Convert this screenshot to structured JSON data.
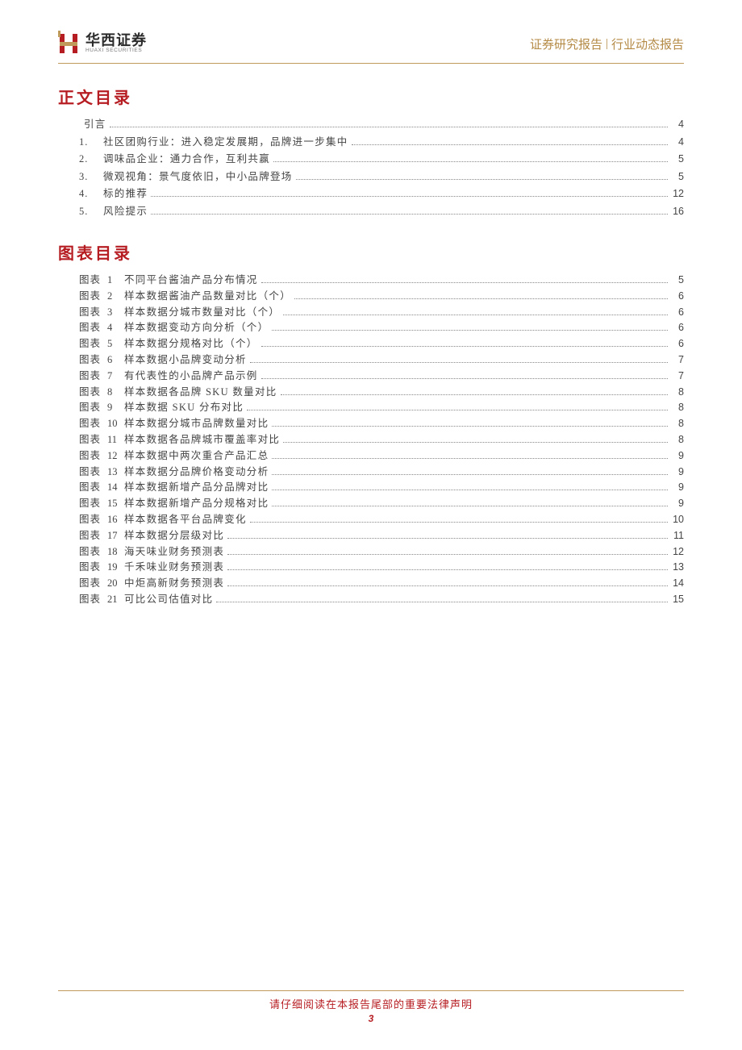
{
  "header": {
    "logo_cn": "华西证券",
    "logo_en": "HUAXI SECURITIES",
    "right_left": "证券研究报告",
    "right_right": "行业动态报告"
  },
  "sections": {
    "toc_title": "正文目录",
    "fig_title": "图表目录"
  },
  "toc": [
    {
      "num": "",
      "title": "引言",
      "page": "4"
    },
    {
      "num": "1.",
      "title": "社区团购行业：进入稳定发展期，品牌进一步集中",
      "page": "4"
    },
    {
      "num": "2.",
      "title": "调味品企业：通力合作，互利共赢",
      "page": "5"
    },
    {
      "num": "3.",
      "title": "微观视角：景气度依旧，中小品牌登场",
      "page": "5"
    },
    {
      "num": "4.",
      "title": "标的推荐",
      "page": "12"
    },
    {
      "num": "5.",
      "title": "风险提示",
      "page": "16"
    }
  ],
  "figures_label": "图表",
  "figures": [
    {
      "n": "1",
      "title": "不同平台酱油产品分布情况",
      "page": "5"
    },
    {
      "n": "2",
      "title": "样本数据酱油产品数量对比（个）",
      "page": "6"
    },
    {
      "n": "3",
      "title": "样本数据分城市数量对比（个）",
      "page": "6"
    },
    {
      "n": "4",
      "title": "样本数据变动方向分析（个）",
      "page": "6"
    },
    {
      "n": "5",
      "title": "样本数据分规格对比（个）",
      "page": "6"
    },
    {
      "n": "6",
      "title": "样本数据小品牌变动分析",
      "page": "7"
    },
    {
      "n": "7",
      "title": "有代表性的小品牌产品示例",
      "page": "7"
    },
    {
      "n": "8",
      "title": "样本数据各品牌 SKU 数量对比",
      "page": "8"
    },
    {
      "n": "9",
      "title": "样本数据 SKU 分布对比",
      "page": "8"
    },
    {
      "n": "10",
      "title": "样本数据分城市品牌数量对比",
      "page": "8"
    },
    {
      "n": "11",
      "title": "样本数据各品牌城市覆盖率对比",
      "page": "8"
    },
    {
      "n": "12",
      "title": "样本数据中两次重合产品汇总",
      "page": "9"
    },
    {
      "n": "13",
      "title": "样本数据分品牌价格变动分析",
      "page": "9"
    },
    {
      "n": "14",
      "title": "样本数据新增产品分品牌对比",
      "page": "9"
    },
    {
      "n": "15",
      "title": "样本数据新增产品分规格对比",
      "page": "9"
    },
    {
      "n": "16",
      "title": "样本数据各平台品牌变化",
      "page": "10"
    },
    {
      "n": "17",
      "title": "样本数据分层级对比",
      "page": "11"
    },
    {
      "n": "18",
      "title": "海天味业财务预测表",
      "page": "12"
    },
    {
      "n": "19",
      "title": "千禾味业财务预测表",
      "page": "13"
    },
    {
      "n": "20",
      "title": "中炬高新财务预测表",
      "page": "14"
    },
    {
      "n": "21",
      "title": "可比公司估值对比",
      "page": "15"
    }
  ],
  "footer": {
    "text": "请仔细阅读在本报告尾部的重要法律声明",
    "page": "3"
  }
}
